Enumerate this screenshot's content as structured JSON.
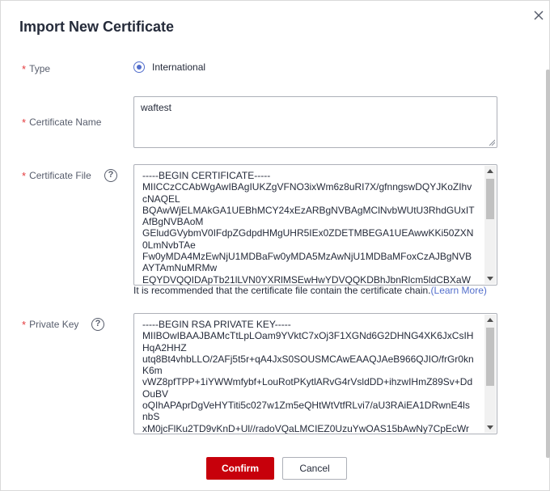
{
  "dialog": {
    "title": "Import New Certificate"
  },
  "form": {
    "type": {
      "label": "Type",
      "option": "International",
      "selected": true
    },
    "certificate_name": {
      "label": "Certificate Name",
      "value": "waftest"
    },
    "certificate_file": {
      "label": "Certificate File",
      "lines": [
        "-----BEGIN CERTIFICATE-----",
        "MIICCzCCAbWgAwIBAgIUKZgVFNO3ixWm6z8uRI7X/gfnngswDQYJKoZIhv",
        "cNAQEL",
        "BQAwWjELMAkGA1UEBhMCY24xEzARBgNVBAgMClNvbWUtU3RhdGUxIT",
        "AfBgNVBAoM",
        "GEludGVybmV0IFdpZGdpdHMgUHR5IEx0ZDETMBEGA1UEAwwKKi50ZXN",
        "0LmNvbTAe",
        "Fw0yMDA4MzEwNjU1MDBaFw0yMDA5MzAwNjU1MDBaMFoxCzAJBgNVB",
        "AYTAmNuMRMw",
        "EQYDVQQIDApTb21lLVN0YXRlMSEwHwYDVQQKDBhJbnRlcm5ldCBXaW"
      ],
      "hint": "It is recommended that the certificate file contain the certificate chain.",
      "hint_link": "(Learn More)"
    },
    "private_key": {
      "label": "Private Key",
      "lines": [
        "-----BEGIN RSA PRIVATE KEY-----",
        "MIIBOwIBAAJBAMcTtLpLOam9YVktC7xOj3F1XGNd6G2DHNG4XK6JxCsIH",
        "HqA2HHZ",
        "utq8Bt4vhbLLO/2AFj5t5r+qA4JxS0SOUSMCAwEAAQJAeB966QJIO/frGr0kn",
        "K6m",
        "vWZ8pfTPP+1iYWWmfybf+LouRotPKytlARvG4rVsldDD+ihzwIHmZ89Sv+Dd",
        "OuBV",
        "oQIhAPAprDgVeHYTiti5c027w1Zm5eQHtWtVtfRLvi7/aU3RAiEA1DRwnE4ls",
        "nbS",
        "xM0jcFlKu2TD9vKnD+Ul//radoVQaLMCIEZ0UzuYwOAS15bAwNy7CpEcWr"
      ]
    }
  },
  "buttons": {
    "confirm": "Confirm",
    "cancel": "Cancel"
  },
  "colors": {
    "primary": "#c7000b",
    "link": "#526ecc",
    "required": "#e4393c"
  },
  "icons": [
    "close-icon",
    "help-icon",
    "radio-checked-icon"
  ]
}
